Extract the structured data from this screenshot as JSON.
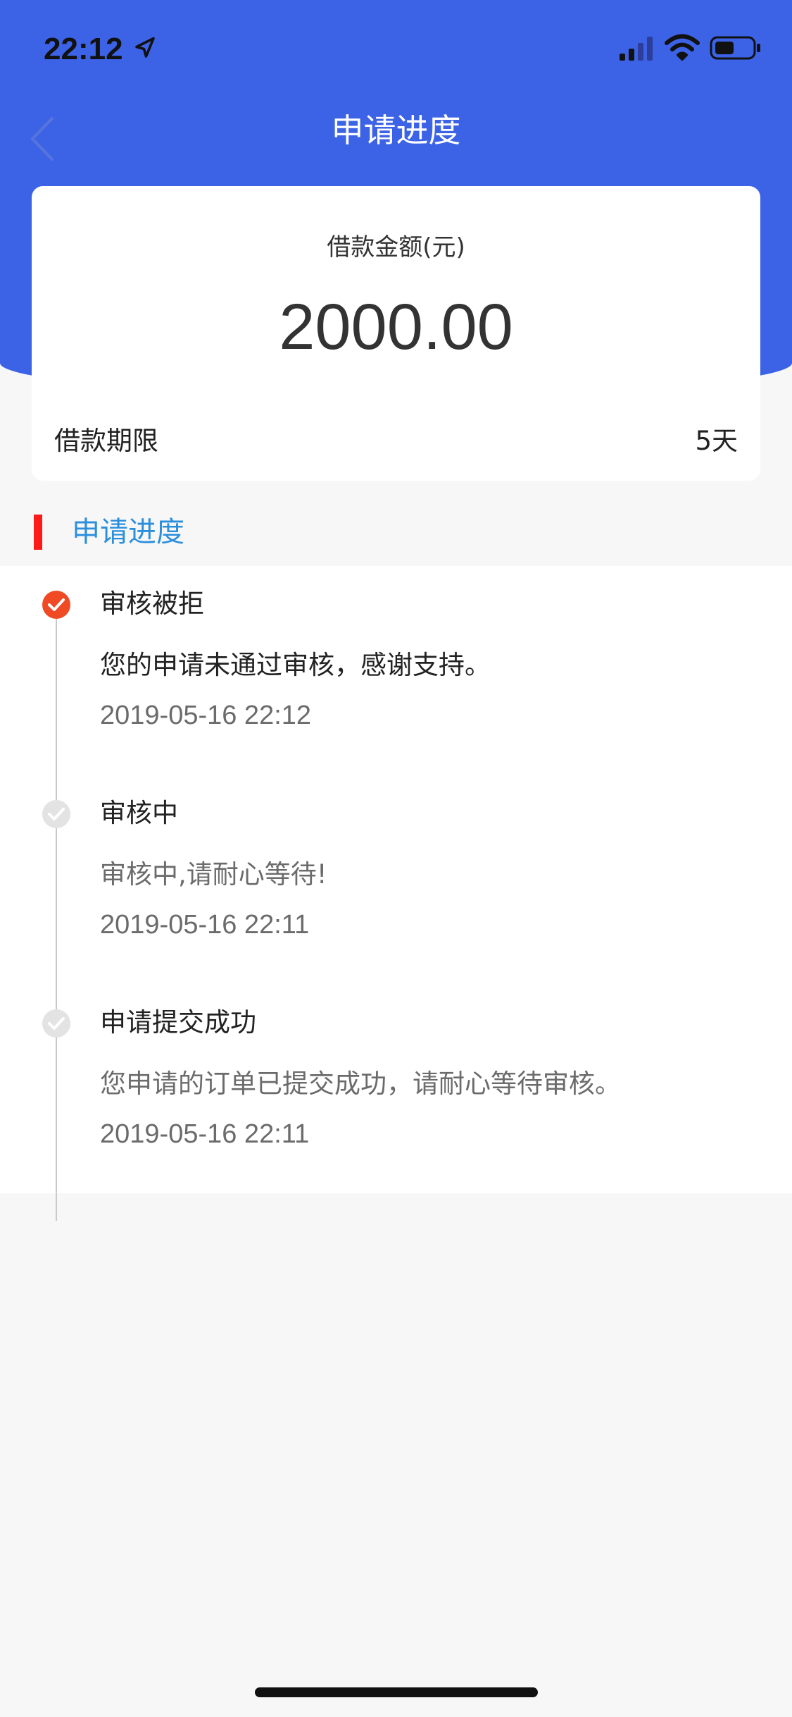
{
  "status_bar": {
    "time": "22:12"
  },
  "header": {
    "title": "申请进度"
  },
  "loan_card": {
    "amount_label": "借款金额(元)",
    "amount": "2000.00",
    "term_label": "借款期限",
    "term_value": "5天"
  },
  "progress_section": {
    "title": "申请进度",
    "steps": [
      {
        "title": "审核被拒",
        "description": "您的申请未通过审核，感谢支持。",
        "time": "2019-05-16 22:12",
        "active": true
      },
      {
        "title": "审核中",
        "description": "审核中,请耐心等待!",
        "time": "2019-05-16 22:11",
        "active": false
      },
      {
        "title": "申请提交成功",
        "description": "您申请的订单已提交成功，请耐心等待审核。",
        "time": "2019-05-16 22:11",
        "active": false
      }
    ]
  },
  "colors": {
    "header_blue": "#3c63e6",
    "accent_red": "#ff1a1a",
    "section_title_blue": "#2b8fdc",
    "active_dot": "#f04a24",
    "inactive_dot": "#e3e3e3"
  },
  "icons": [
    "location-arrow-icon",
    "signal-icon",
    "wifi-icon",
    "battery-icon",
    "back-chevron-icon",
    "check-icon"
  ]
}
